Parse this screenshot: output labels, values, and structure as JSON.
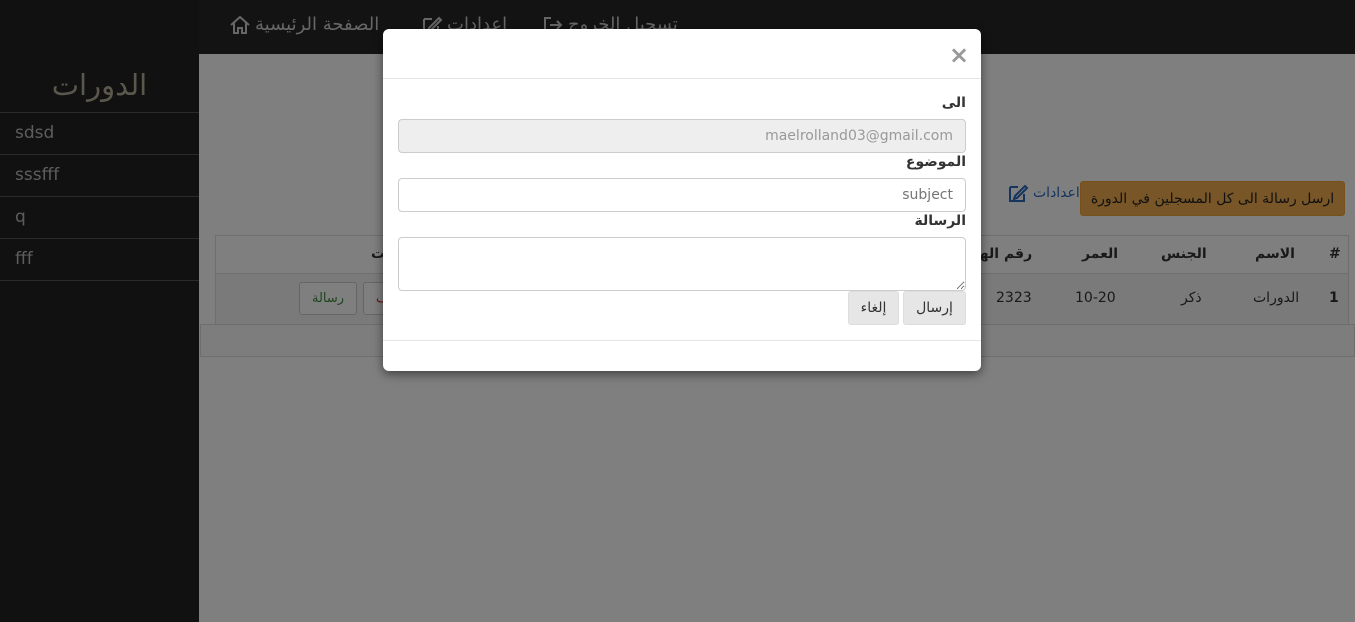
{
  "sidebar": {
    "title": "الدورات",
    "items": [
      {
        "label": "sdsd"
      },
      {
        "label": "sssfff"
      },
      {
        "label": "q"
      },
      {
        "label": "fff"
      }
    ]
  },
  "topbar": {
    "home_label": "الصفحة الرئيسية",
    "settings_label": "اعدادات",
    "logout_label": "تسجيل الخروج"
  },
  "main": {
    "settings_link": "اعدادات",
    "broadcast_button": "ارسل رسالة الى كل المسجلين في الدورة",
    "table": {
      "headers": {
        "number": "#",
        "name": "الاسم",
        "gender": "الجنس",
        "age": "العمر",
        "phone": "رقم الهو",
        "actions": "ت"
      },
      "rows": [
        {
          "number": "1",
          "name": "الدورات",
          "gender": "ذكر",
          "age": "10-20",
          "phone": "2323",
          "message_button": "رسالة",
          "delete_button": "ف"
        }
      ]
    }
  },
  "modal": {
    "close": "×",
    "to_label": "الى",
    "to_value": "maelrolland03@gmail.com",
    "subject_label": "الموضوع",
    "subject_placeholder": "subject",
    "message_label": "الرسالة",
    "message_value": "",
    "send_button": "إرسال",
    "cancel_button": "إلغاء"
  }
}
